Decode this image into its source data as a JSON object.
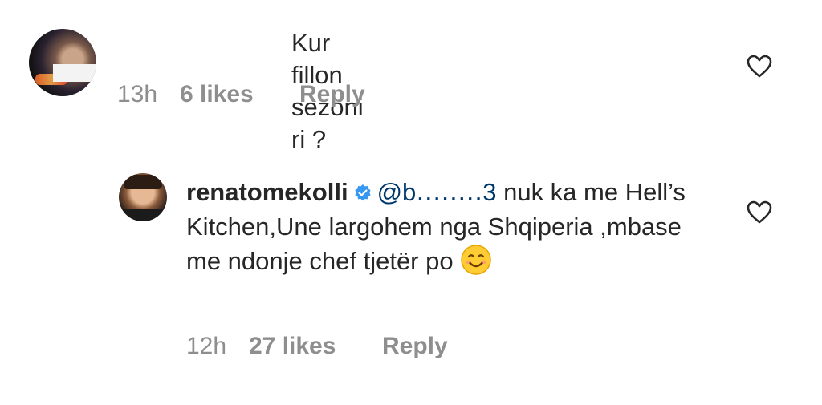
{
  "comments": [
    {
      "text": "Kur fillon sezoni ri ?",
      "time": "13h",
      "likes": "6 likes",
      "reply_label": "Reply",
      "avatar": "user-avatar-censored",
      "like_icon": "heart-outline-icon"
    },
    {
      "username": "renatomekolli",
      "verified_icon": "verified-badge-icon",
      "mention": "@b․․․․․․․․3",
      "text": " nuk ka me Hell’s Kitchen,Une largohem nga Shqiperia ,mbase me ndonje chef tjetër po",
      "emoji": "smiling-face-emoji",
      "time": "12h",
      "likes": "27 likes",
      "reply_label": "Reply",
      "avatar": "renatomekolli-avatar",
      "like_icon": "heart-outline-icon"
    }
  ],
  "colors": {
    "text": "#262626",
    "secondary": "#8e8e8e",
    "mention": "#00376b",
    "verified": "#3897f0",
    "background": "#ffffff"
  }
}
